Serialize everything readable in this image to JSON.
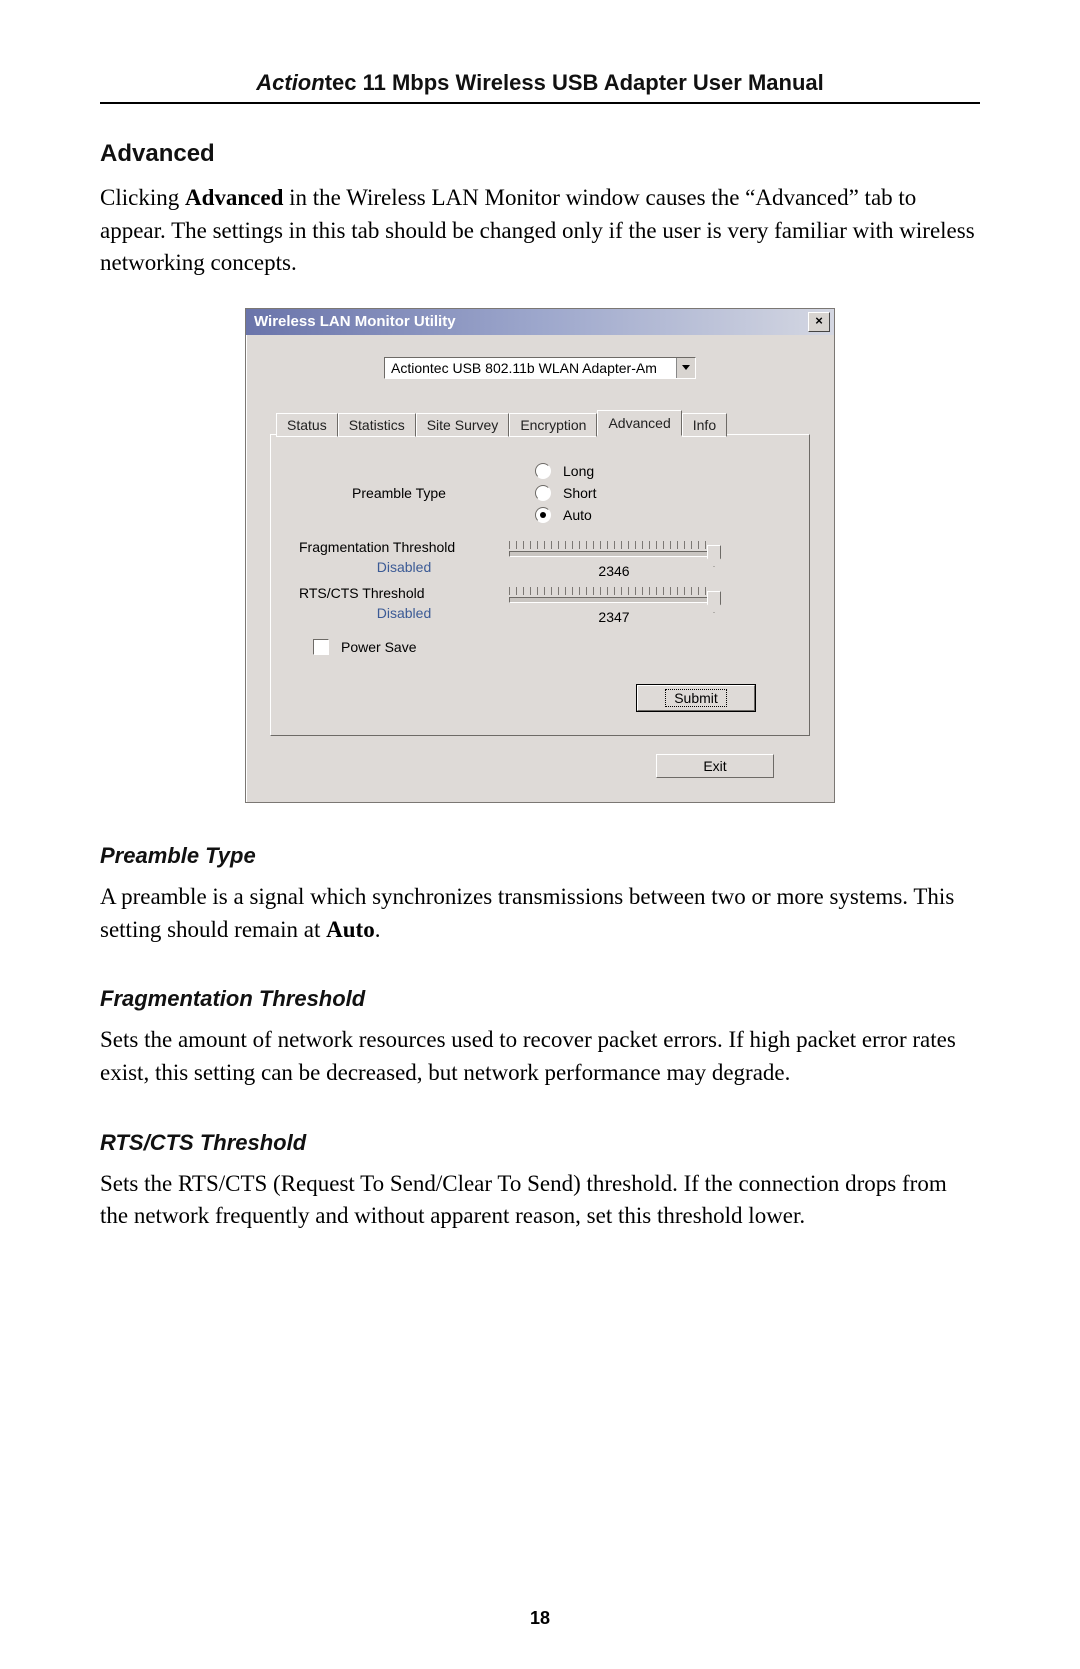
{
  "header": {
    "brand": "Action",
    "brand_suffix": "tec",
    "title_rest": " 11 Mbps Wireless USB Adapter User Manual"
  },
  "section": {
    "heading": "Advanced",
    "intro_prefix": "Clicking ",
    "intro_bold": "Advanced",
    "intro_rest": " in the Wireless LAN Monitor window causes the “Advanced” tab to appear. The settings in this tab should be changed only if the user is very familiar with wireless networking concepts."
  },
  "dialog": {
    "title": "Wireless LAN Monitor Utility",
    "close_glyph": "×",
    "adapter": "Actiontec USB 802.11b WLAN Adapter-Am",
    "tabs": [
      "Status",
      "Statistics",
      "Site Survey",
      "Encryption",
      "Advanced",
      "Info"
    ],
    "active_tab_index": 4,
    "preamble": {
      "label": "Preamble Type",
      "options": [
        "Long",
        "Short",
        "Auto"
      ],
      "selected_index": 2
    },
    "frag": {
      "label": "Fragmentation Threshold",
      "status": "Disabled",
      "value": "2346"
    },
    "rts": {
      "label": "RTS/CTS Threshold",
      "status": "Disabled",
      "value": "2347"
    },
    "power_save": {
      "label": "Power Save",
      "checked": false
    },
    "buttons": {
      "submit": "Submit",
      "exit": "Exit"
    }
  },
  "subsections": {
    "preamble": {
      "heading": "Preamble Type",
      "text_prefix": "A preamble is a signal which synchronizes transmissions between two or more systems. This setting should remain at ",
      "text_bold": "Auto",
      "text_suffix": "."
    },
    "frag": {
      "heading": "Fragmentation Threshold",
      "text": "Sets the amount of network resources used to recover packet errors. If high packet error rates exist, this setting can be decreased, but network performance may degrade."
    },
    "rts": {
      "heading": "RTS/CTS Threshold",
      "text": "Sets the RTS/CTS (Request To Send/Clear To Send) threshold. If the connection drops from the network frequently and without apparent reason, set this threshold lower."
    }
  },
  "page_number": "18"
}
